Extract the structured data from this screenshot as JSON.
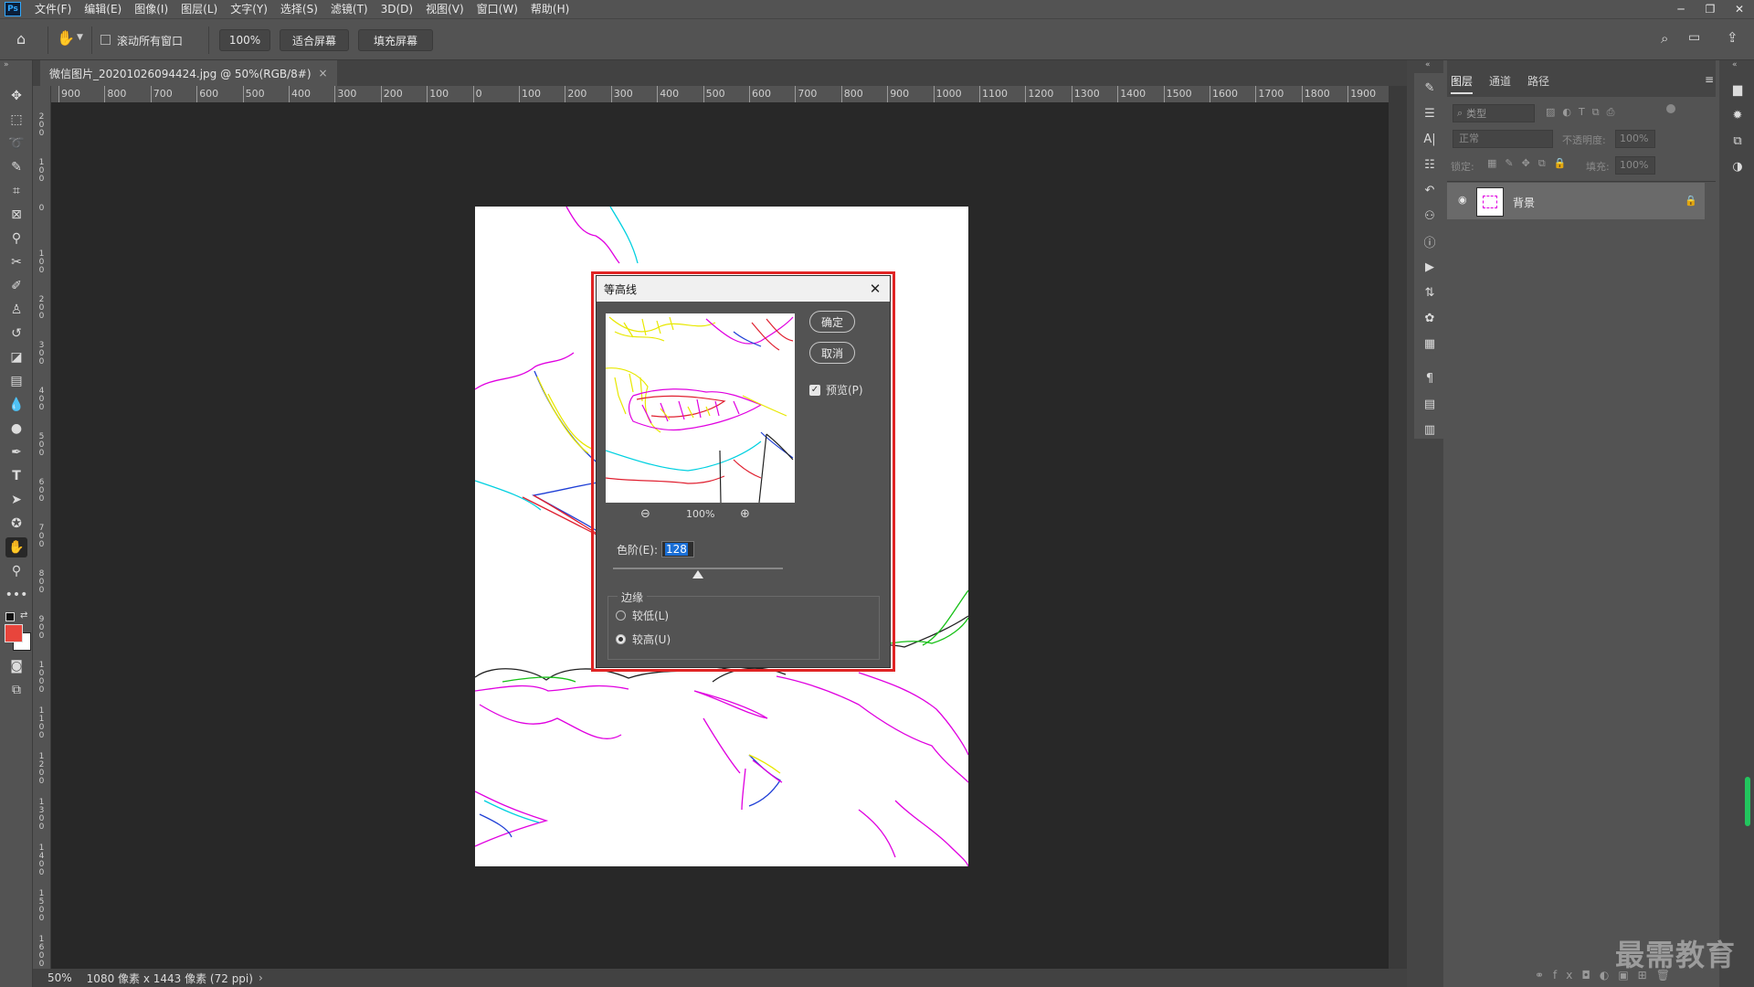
{
  "app": {
    "logo": "Ps"
  },
  "menu": [
    "文件(F)",
    "编辑(E)",
    "图像(I)",
    "图层(L)",
    "文字(Y)",
    "选择(S)",
    "滤镜(T)",
    "3D(D)",
    "视图(V)",
    "窗口(W)",
    "帮助(H)"
  ],
  "window_controls": {
    "minimize": "─",
    "restore": "❐",
    "close": "✕"
  },
  "options_bar": {
    "scroll_all_label": "滚动所有窗口",
    "zoom_value": "100%",
    "fit_screen": "适合屏幕",
    "fill_screen": "填充屏幕"
  },
  "document": {
    "tab_title": "微信图片_20201026094424.jpg @ 50%(RGB/8#)",
    "tab_close": "×"
  },
  "ruler": {
    "h_labels": [
      "900",
      "800",
      "700",
      "600",
      "500",
      "400",
      "300",
      "200",
      "100",
      "0",
      "100",
      "200",
      "300",
      "400",
      "500",
      "600",
      "700",
      "800",
      "900",
      "1000",
      "1100",
      "1200",
      "1300",
      "1400",
      "1500",
      "1600",
      "1700",
      "1800",
      "1900"
    ],
    "v_labels": [
      "200",
      "100",
      "0",
      "100",
      "200",
      "300",
      "400",
      "500",
      "600",
      "700",
      "800",
      "900",
      "1000",
      "1100",
      "1200",
      "1300",
      "1400",
      "1500",
      "1600"
    ]
  },
  "status": {
    "zoom": "50%",
    "info": "1080 像素 x 1443 像素 (72 ppi)",
    "arrow": "›"
  },
  "dialog": {
    "title": "等高线",
    "close": "✕",
    "ok": "确定",
    "cancel": "取消",
    "preview_label": "预览(P)",
    "preview_checked": true,
    "zoom": "100%",
    "level_label": "色阶(E):",
    "level_value": "128",
    "level_fraction": 0.502,
    "edge_group": "边缘",
    "edge_lower": "较低(L)",
    "edge_upper": "较高(U)",
    "edge_selected": "upper"
  },
  "layers_panel": {
    "tabs": [
      "图层",
      "通道",
      "路径"
    ],
    "filter_placeholder": "类型",
    "blend_mode": "正常",
    "opacity_label": "不透明度:",
    "opacity_value": "100%",
    "lock_label": "锁定:",
    "fill_label": "填充:",
    "fill_value": "100%",
    "layer_name": "背景"
  },
  "watermark": "最需教育",
  "colors": {
    "foreground": "#e8453c",
    "background": "#ffffff",
    "highlight": "#e02424"
  }
}
